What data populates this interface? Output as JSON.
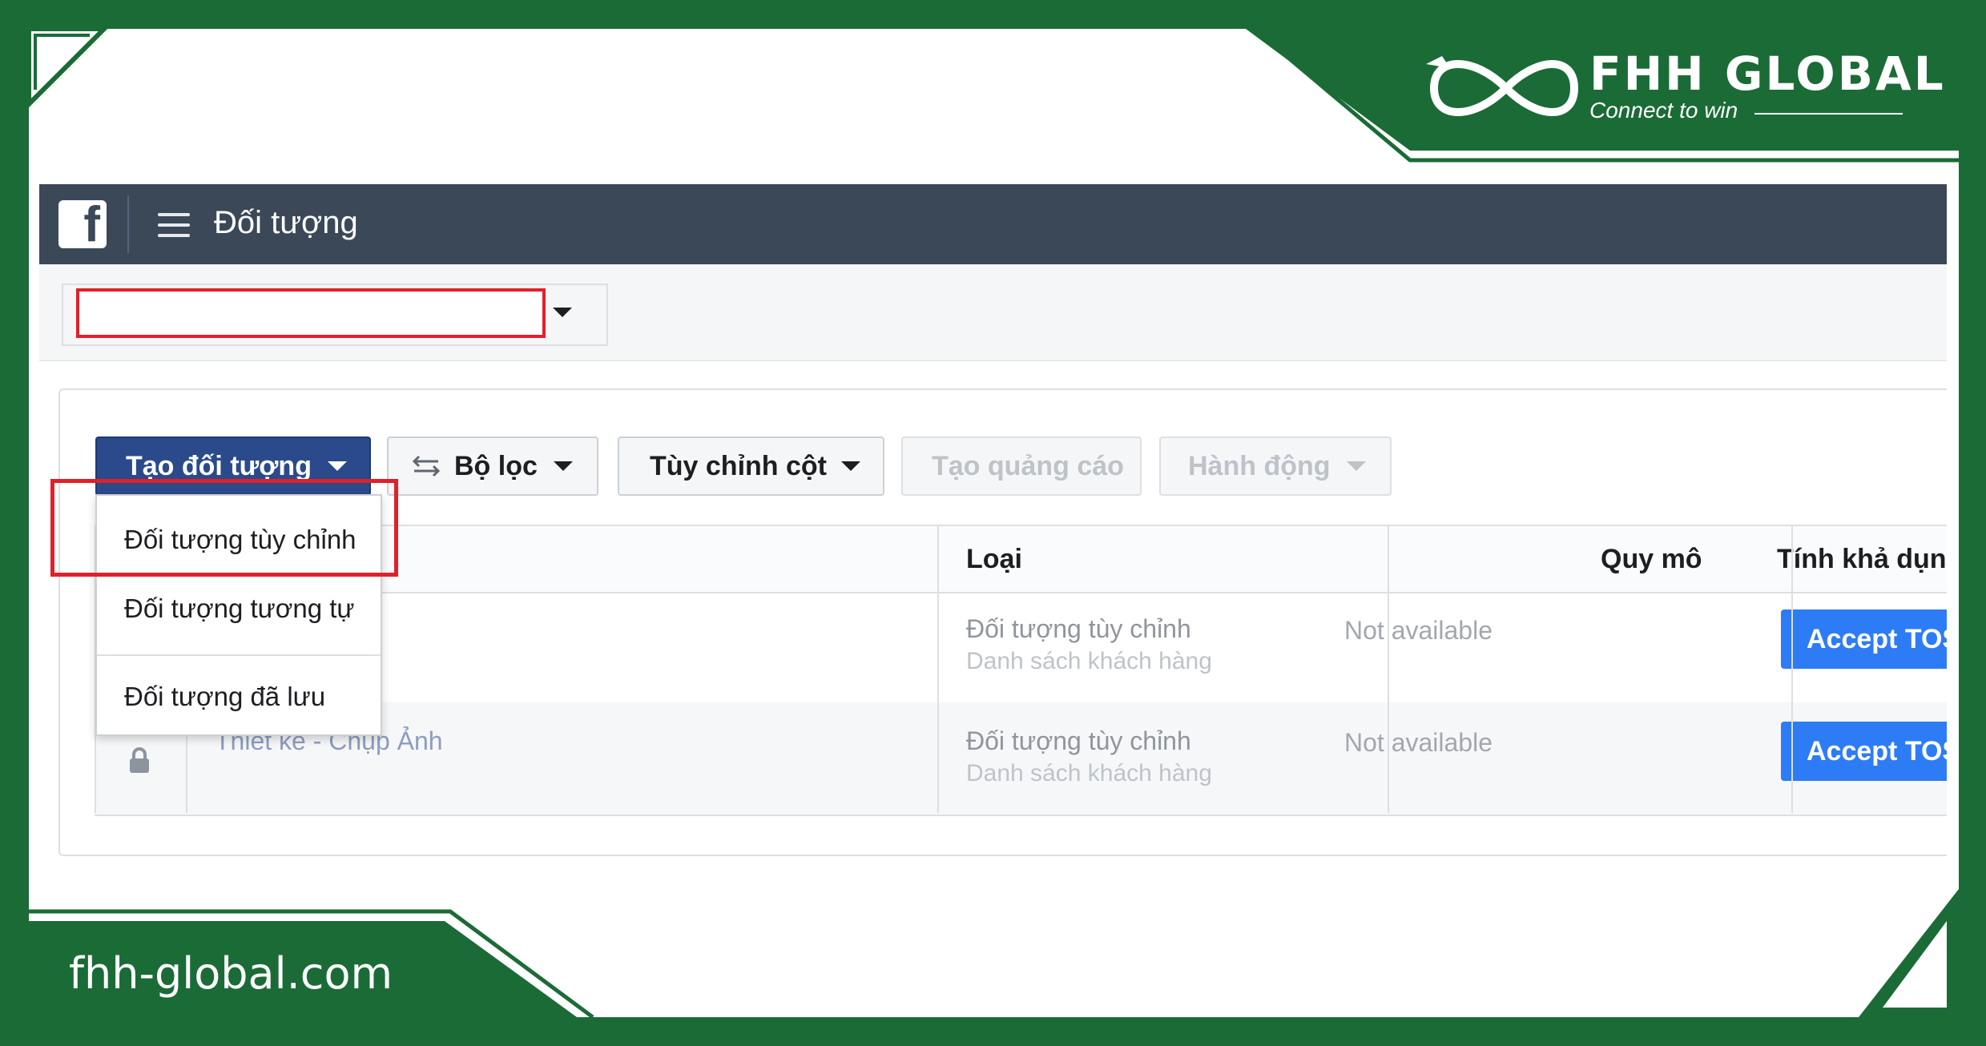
{
  "brand": {
    "name": "FHH GLOBAL",
    "tagline": "Connect to win",
    "website": "fhh-global.com",
    "color": "#1b6b36"
  },
  "app": {
    "page_title": "Đối tượng",
    "logo_glyph": "f",
    "accent_color": "#2b4a8c"
  },
  "account_selector": {
    "value": ""
  },
  "toolbar": {
    "create_audience": "Tạo đối tượng",
    "filter": "Bộ lọc",
    "customize_columns": "Tùy chỉnh cột",
    "create_ad": "Tạo quảng cáo",
    "actions": "Hành động"
  },
  "create_menu": {
    "items": [
      {
        "label": "Đối tượng tùy chỉnh"
      },
      {
        "label": "Đối tượng tương tự"
      },
      {
        "label": "Đối tượng đã lưu"
      }
    ]
  },
  "table": {
    "columns": {
      "type": "Loại",
      "size": "Quy mô",
      "availability": "Tính khả dụng"
    },
    "rows": [
      {
        "name": "",
        "type": "Đối tượng tùy chỉnh",
        "subtype": "Danh sách khách hàng",
        "size": "Not available",
        "action": "Accept TOS"
      },
      {
        "name": "Thiết kế - Chụp Ảnh",
        "type": "Đối tượng tùy chỉnh",
        "subtype": "Danh sách khách hàng",
        "size": "Not available",
        "action": "Accept TOS"
      }
    ]
  }
}
